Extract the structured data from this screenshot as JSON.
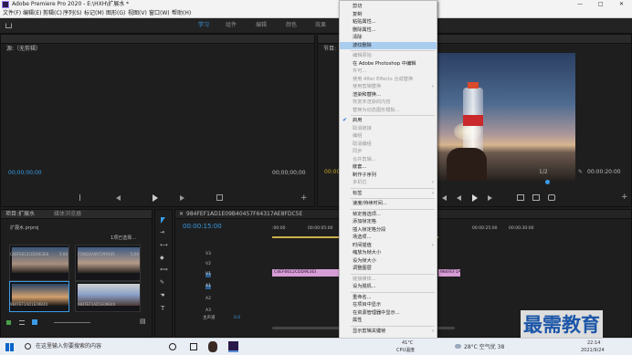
{
  "window": {
    "title": "Adobe Premiere Pro 2020 - E:\\HXH\\扩展水 *",
    "min": "—",
    "max": "□",
    "close": "✕"
  },
  "menu": [
    "文件(F)",
    "编辑(E)",
    "剪辑(C)",
    "序列(S)",
    "标记(M)",
    "图形(G)",
    "视图(V)",
    "窗口(W)",
    "帮助(H)"
  ],
  "workspaces": [
    "学习",
    "组件",
    "编辑",
    "颜色",
    "效果"
  ],
  "source": {
    "title": "源:（无剪辑）",
    "tc_left": "00;00;00;00",
    "tc_right": "00;00;00;00"
  },
  "program": {
    "title": "节目:",
    "tc_left": "00:00:00:00",
    "ratio": "1/2",
    "tc_right": "00:00:20:00"
  },
  "project": {
    "title": "项目:扩展水",
    "tab2": "媒体浏览器",
    "file": "扩展水.prproj",
    "selected": "1项已选择...",
    "items": [
      {
        "name": "C4EF6612CDD9E3E8",
        "dur": "5:00"
      },
      {
        "name": "F5082EA697299305",
        "dur": "5:00"
      },
      {
        "name": "984FEF1AD1E09B40",
        "dur": ""
      },
      {
        "name": "984FEF1AD1E09B40",
        "dur": ""
      }
    ]
  },
  "timeline": {
    "title": "984FEF1AD1E09B40457F64317AE8FDC5E",
    "timecode": "00:00:15:00",
    "ruler": [
      ":00:00",
      "00:00:05:00",
      "00:00:25:00",
      "00:00:30:00"
    ],
    "tracks": [
      "V3",
      "V2",
      "V1",
      "A1",
      "A2",
      "A3"
    ],
    "master": "主声道",
    "master_val": "0.0",
    "clips": [
      "C4EF6612CDD9E3E8",
      "984FEF1AD1E09B40"
    ]
  },
  "context_menu": [
    {
      "label": "剪切",
      "dis": false
    },
    {
      "label": "复制",
      "dis": false
    },
    {
      "label": "粘贴属性...",
      "dis": false
    },
    {
      "label": "删除属性...",
      "dis": false
    },
    {
      "label": "清除",
      "dis": false
    },
    {
      "label": "波纹删除",
      "hl": true
    },
    {
      "sep": true
    },
    {
      "label": "编辑原始",
      "dis": true
    },
    {
      "label": "在 Adobe Photoshop 中编辑",
      "dis": false
    },
    {
      "label": "许可...",
      "dis": true
    },
    {
      "label": "使用 After Effects 合成替换",
      "dis": true
    },
    {
      "label": "使用剪辑替换",
      "dis": true,
      "sub": true
    },
    {
      "label": "渲染和替换...",
      "dis": false
    },
    {
      "label": "恢复未渲染的内容",
      "dis": true
    },
    {
      "label": "restore",
      "dis": true,
      "text": "替换为动态图形模板..."
    },
    {
      "sep": true
    },
    {
      "label": "启用",
      "check": true
    },
    {
      "label": "取消链接",
      "dis": true
    },
    {
      "label": "编组",
      "dis": true
    },
    {
      "label": "取消编组",
      "dis": true
    },
    {
      "label": "同步",
      "dis": true
    },
    {
      "label": "合并剪辑...",
      "dis": true
    },
    {
      "label": "嵌套...",
      "dis": false
    },
    {
      "label": "制作子序列",
      "dis": false
    },
    {
      "label": "多机位",
      "dis": true,
      "sub": true
    },
    {
      "sep": true
    },
    {
      "label": "标签",
      "dis": false,
      "sub": true
    },
    {
      "sep": true
    },
    {
      "label": "速度/持续时间...",
      "dis": false
    },
    {
      "sep": true
    },
    {
      "label": "帧定格选项...",
      "dis": false
    },
    {
      "label": "添加帧定格",
      "dis": false
    },
    {
      "label": "插入帧定格分段",
      "dis": false
    },
    {
      "label": "场选项...",
      "dis": false
    },
    {
      "label": "时间插值",
      "dis": false,
      "sub": true
    },
    {
      "label": "缩放为帧大小",
      "dis": false
    },
    {
      "label": "设为帧大小",
      "dis": false
    },
    {
      "label": "调整图层",
      "dis": false
    },
    {
      "sep": true
    },
    {
      "label": "链接媒体...",
      "dis": true
    },
    {
      "label": "设为脱机...",
      "dis": false
    },
    {
      "sep": true
    },
    {
      "label": "重命名...",
      "dis": false
    },
    {
      "label": "在项目中显示",
      "dis": false
    },
    {
      "label": "在资源管理器中显示...",
      "dis": false
    },
    {
      "label": "属性",
      "dis": false
    },
    {
      "sep": true
    },
    {
      "label": "显示剪辑关键帧",
      "dis": false,
      "sub": true
    }
  ],
  "taskbar": {
    "search": "在这里输入你要搜索的内容",
    "cpu": "41°C",
    "cpu_label": "CPU温度",
    "weather": "28°C 空气优 38",
    "time": "22:14",
    "date": "2021/9/24",
    "watermark": "最需教育"
  }
}
